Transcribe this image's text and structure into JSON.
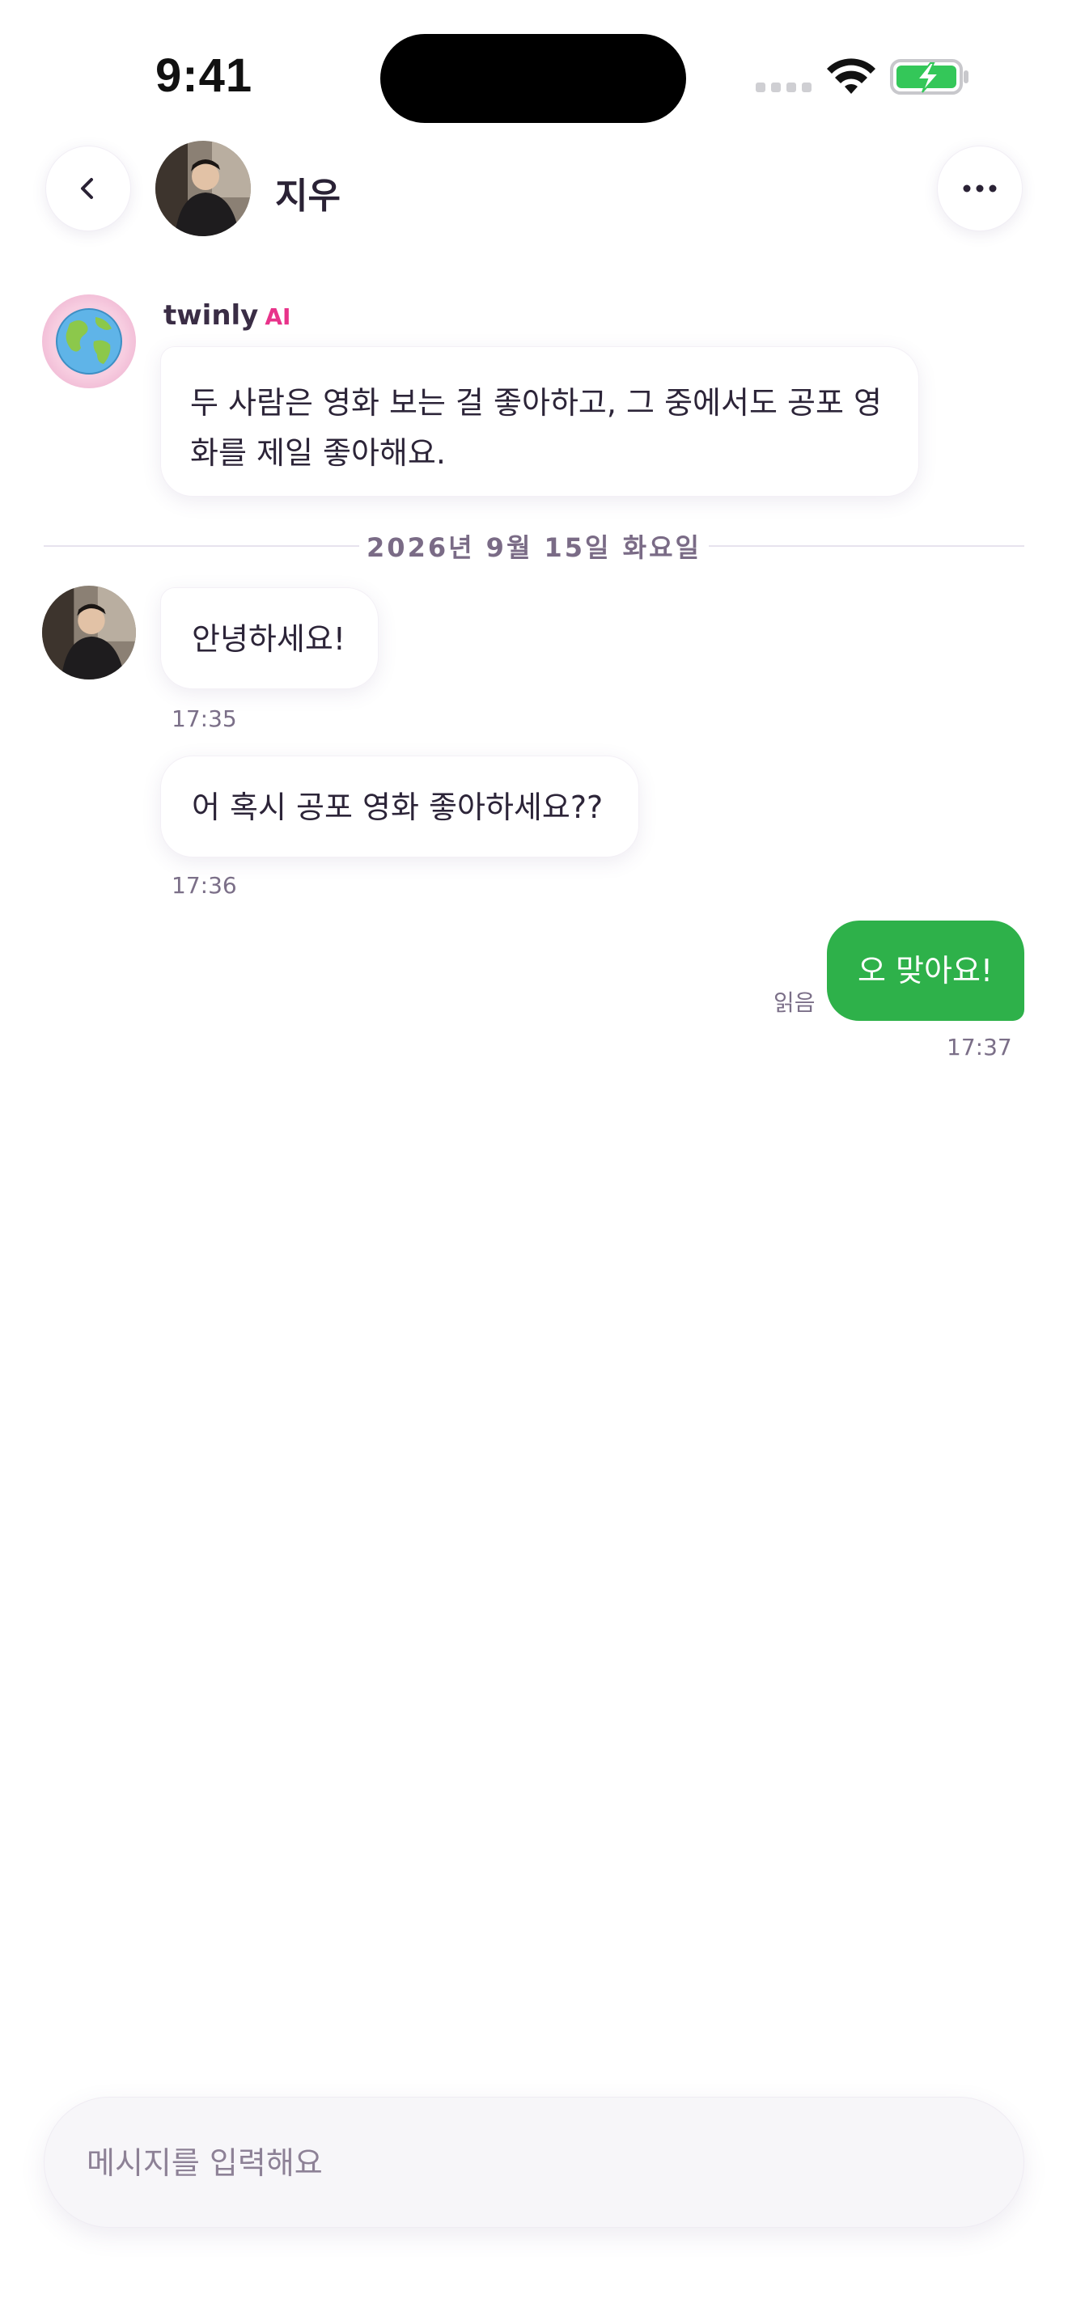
{
  "status_bar": {
    "time": "9:41"
  },
  "header": {
    "partner_name": "지우"
  },
  "ai_message": {
    "sender_name": "twinly",
    "sender_tag": "AI",
    "text": "두 사람은 영화 보는 걸 좋아하고, 그 중에서도 공포 영화를 제일 좋아해요."
  },
  "date_divider": "2026년 9월 15일 화요일",
  "messages": [
    {
      "text": "안녕하세요!",
      "time": "17:35"
    },
    {
      "text": "어 혹시 공포 영화 좋아하세요??",
      "time": "17:36"
    },
    {
      "text": "오 맞아요!",
      "time": "17:37",
      "read_label": "읽음"
    }
  ],
  "input": {
    "placeholder": "메시지를 입력해요",
    "value": ""
  },
  "colors": {
    "accent_green": "#2eb14a",
    "ai_pink": "#e8338a"
  }
}
